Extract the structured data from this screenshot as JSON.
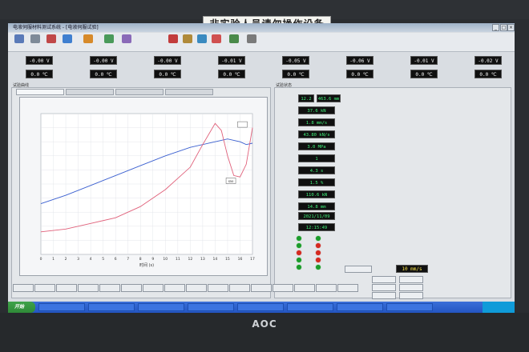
{
  "notice": "非实验人员请勿操作设备",
  "window": {
    "title": "电液伺服材料测试系统 - [电液伺服试验]"
  },
  "toolbar": [
    "",
    "",
    "",
    "",
    "",
    "",
    "",
    "",
    "",
    "",
    "",
    "",
    ""
  ],
  "row1": [
    {
      "label": "",
      "value": "-0.00 V"
    },
    {
      "label": "",
      "value": "-0.00 V"
    },
    {
      "label": "",
      "value": "-0.00 V"
    },
    {
      "label": "",
      "value": "-0.01 V"
    },
    {
      "label": "",
      "value": "-0.05 V"
    },
    {
      "label": "",
      "value": "-0.06 V"
    },
    {
      "label": "",
      "value": "-0.01 V"
    },
    {
      "label": "",
      "value": "-0.02 V"
    }
  ],
  "row2": [
    {
      "label": "",
      "value": "0.0 ℃"
    },
    {
      "label": "",
      "value": "0.0 ℃"
    },
    {
      "label": "",
      "value": "0.0 ℃"
    },
    {
      "label": "",
      "value": "0.0 ℃"
    },
    {
      "label": "",
      "value": "0.0 ℃"
    },
    {
      "label": "",
      "value": "0.0 ℃"
    },
    {
      "label": "",
      "value": "0.0 ℃"
    },
    {
      "label": "",
      "value": "0.0 ℃"
    }
  ],
  "left_panel_label": "试验曲线",
  "right_panel_label": "试验状态",
  "tabs": [
    "",
    "",
    "",
    ""
  ],
  "chart_data": {
    "type": "line",
    "title": "",
    "xlabel": "时间 (s)",
    "ylabel": "",
    "xlim": [
      0,
      17
    ],
    "x_ticks": [
      "0",
      "1",
      "2",
      "3",
      "4",
      "5",
      "6",
      "7",
      "8",
      "9",
      "10",
      "11",
      "12",
      "13",
      "14",
      "15",
      "16",
      "17"
    ],
    "series": [
      {
        "color": "#3a5fd0",
        "x": [
          0,
          2,
          4,
          6,
          8,
          10,
          12,
          14,
          15,
          16,
          16.5,
          17
        ],
        "y": [
          0.36,
          0.42,
          0.49,
          0.56,
          0.63,
          0.7,
          0.76,
          0.8,
          0.82,
          0.8,
          0.78,
          0.79
        ]
      },
      {
        "color": "#e0607a",
        "x": [
          0,
          2,
          4,
          6,
          8,
          10,
          12,
          13,
          14,
          14.5,
          15,
          15.5,
          16,
          16.5,
          17
        ],
        "y": [
          0.16,
          0.18,
          0.22,
          0.26,
          0.34,
          0.46,
          0.62,
          0.78,
          0.93,
          0.88,
          0.7,
          0.56,
          0.55,
          0.64,
          0.9
        ]
      }
    ],
    "markers": [
      "",
      "S50"
    ],
    "legend": [
      "",
      "",
      ""
    ]
  },
  "readouts": [
    {
      "label": "",
      "value": "12.2",
      "value2": "463.6 mm"
    },
    {
      "label": "",
      "value": "37.6 kN"
    },
    {
      "label": "",
      "value": "1.8 mm/s"
    },
    {
      "label": "",
      "value": "43.80 kN/s"
    },
    {
      "label": "",
      "value": "3.0 MPa"
    },
    {
      "label": "",
      "value": "1"
    },
    {
      "label": "",
      "value": "4.3 s"
    },
    {
      "label": "",
      "value": "1.5 %"
    },
    {
      "label": "",
      "value": "110.6 kN"
    },
    {
      "label": "",
      "value": "14.8 mm"
    }
  ],
  "datetime": {
    "date": "2021/11/09",
    "time": "12:15:49"
  },
  "status_leds": [
    {
      "label": "",
      "color": "g"
    },
    {
      "label": "",
      "color": "g"
    },
    {
      "label": "",
      "color": "g"
    },
    {
      "label": "",
      "color": "r"
    },
    {
      "label": "",
      "color": "r"
    },
    {
      "label": "",
      "color": "r"
    },
    {
      "label": "",
      "color": "g"
    },
    {
      "label": "",
      "color": "r"
    },
    {
      "label": "",
      "color": "g"
    },
    {
      "label": "",
      "color": "g"
    }
  ],
  "rate_box": {
    "label": "",
    "value": "10 mm/s"
  },
  "bottom_buttons": [
    "",
    "",
    "",
    "",
    "",
    "",
    "",
    "",
    "",
    "",
    "",
    "",
    "",
    "",
    "",
    ""
  ],
  "right_buttons": [
    "",
    "",
    "",
    "",
    "",
    ""
  ],
  "taskbar": {
    "start": "开始",
    "tasks": [
      "",
      "",
      "",
      "",
      "",
      "",
      "",
      ""
    ],
    "clock": ""
  },
  "brand": "AOC"
}
